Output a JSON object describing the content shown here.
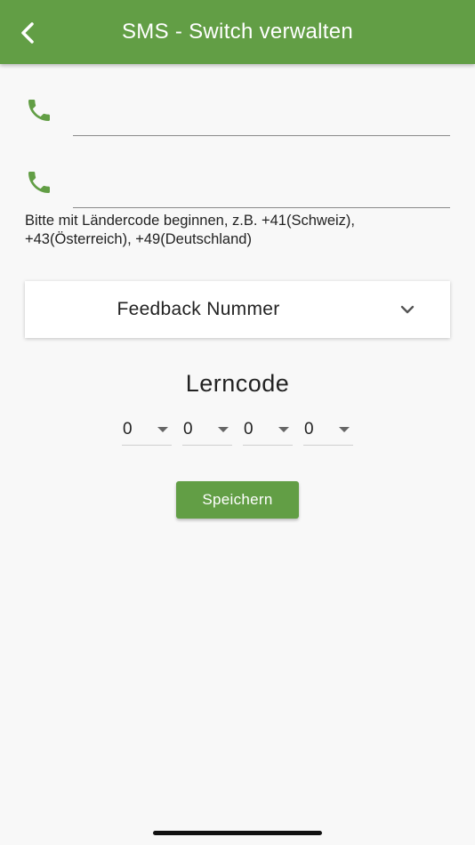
{
  "colors": {
    "accent": "#629e45",
    "background": "#f8f8f8"
  },
  "appbar": {
    "title": "SMS - Switch verwalten",
    "back_icon": "chevron-left-icon"
  },
  "phone_fields": [
    {
      "icon": "phone-icon",
      "value": ""
    },
    {
      "icon": "phone-icon",
      "value": ""
    }
  ],
  "hint": {
    "text": "Bitte mit Ländercode beginnen, z.B. +41(Schweiz), +43(Österreich), +49(Deutschland)"
  },
  "feedback_dropdown": {
    "label": "Feedback Nummer",
    "icon": "chevron-down-icon"
  },
  "lerncode": {
    "title": "Lerncode",
    "digits": [
      "0",
      "0",
      "0",
      "0"
    ]
  },
  "save_button": {
    "label": "Speichern"
  }
}
